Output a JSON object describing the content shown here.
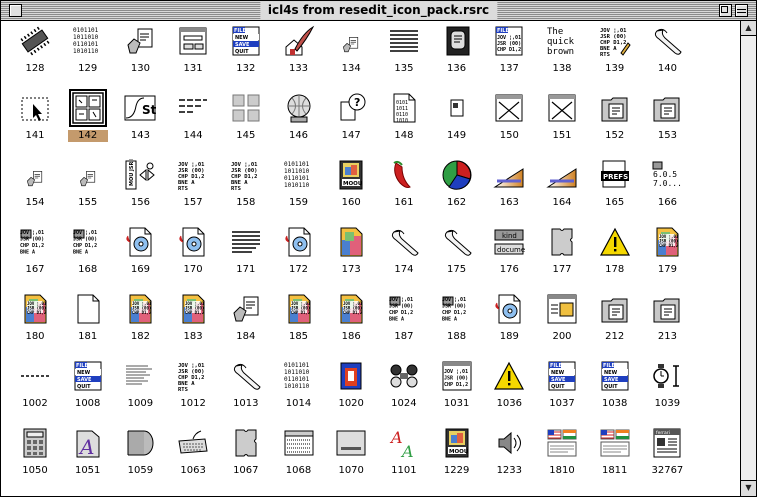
{
  "window": {
    "title": "icl4s from resedit_icon_pack.rsrc"
  },
  "selected_id": "142",
  "icons": [
    {
      "id": "128",
      "name": "chip-icon"
    },
    {
      "id": "129",
      "name": "binary-text-icon"
    },
    {
      "id": "130",
      "name": "hand-document-icon"
    },
    {
      "id": "131",
      "name": "dialog-window-icon"
    },
    {
      "id": "132",
      "name": "file-menu-icon"
    },
    {
      "id": "133",
      "name": "house-feather-icon"
    },
    {
      "id": "134",
      "name": "hand-document-small-icon"
    },
    {
      "id": "135",
      "name": "horizontal-lines-icon"
    },
    {
      "id": "136",
      "name": "dark-document-icon"
    },
    {
      "id": "137",
      "name": "code-menu-icon"
    },
    {
      "id": "138",
      "name": "quick-brown-text-icon"
    },
    {
      "id": "139",
      "name": "code-pencil-icon"
    },
    {
      "id": "140",
      "name": "scroll-icon"
    },
    {
      "id": "141",
      "name": "cursor-selection-icon"
    },
    {
      "id": "142",
      "name": "document-grid-icon"
    },
    {
      "id": "143",
      "name": "stylus-curve-icon"
    },
    {
      "id": "144",
      "name": "dashed-lines-icon"
    },
    {
      "id": "145",
      "name": "four-squares-icon"
    },
    {
      "id": "146",
      "name": "globe-icon"
    },
    {
      "id": "147",
      "name": "question-document-icon"
    },
    {
      "id": "148",
      "name": "binary-page-icon"
    },
    {
      "id": "149",
      "name": "small-document-icon"
    },
    {
      "id": "150",
      "name": "crossed-box-icon"
    },
    {
      "id": "151",
      "name": "crossed-box-icon"
    },
    {
      "id": "152",
      "name": "folder-document-icon"
    },
    {
      "id": "153",
      "name": "folder-document-icon"
    },
    {
      "id": "154",
      "name": "small-hand-document-icon"
    },
    {
      "id": "155",
      "name": "small-hand-document-icon"
    },
    {
      "id": "156",
      "name": "vertical-panel-icon"
    },
    {
      "id": "157",
      "name": "code-listing-icon"
    },
    {
      "id": "158",
      "name": "code-listing-icon"
    },
    {
      "id": "159",
      "name": "binary-text-icon"
    },
    {
      "id": "160",
      "name": "film-strip-icon"
    },
    {
      "id": "161",
      "name": "chili-pepper-icon"
    },
    {
      "id": "162",
      "name": "pie-chart-icon"
    },
    {
      "id": "163",
      "name": "gradient-ramp-icon"
    },
    {
      "id": "164",
      "name": "gradient-ramp-icon"
    },
    {
      "id": "165",
      "name": "prefs-tag-icon"
    },
    {
      "id": "166",
      "name": "version-document-icon"
    },
    {
      "id": "167",
      "name": "code-stack-icon"
    },
    {
      "id": "168",
      "name": "code-stack-icon"
    },
    {
      "id": "169",
      "name": "cd-document-icon"
    },
    {
      "id": "170",
      "name": "cd-document-icon"
    },
    {
      "id": "171",
      "name": "fading-lines-icon"
    },
    {
      "id": "172",
      "name": "cd-document-icon"
    },
    {
      "id": "173",
      "name": "color-document-icon"
    },
    {
      "id": "174",
      "name": "scroll-icon"
    },
    {
      "id": "175",
      "name": "scroll-icon"
    },
    {
      "id": "176",
      "name": "kind-document-label-icon"
    },
    {
      "id": "177",
      "name": "puzzle-piece-icon"
    },
    {
      "id": "178",
      "name": "warning-triangle-icon"
    },
    {
      "id": "179",
      "name": "color-code-document-icon"
    },
    {
      "id": "180",
      "name": "color-code-document-icon"
    },
    {
      "id": "181",
      "name": "blank-document-icon"
    },
    {
      "id": "182",
      "name": "color-code-document-icon"
    },
    {
      "id": "183",
      "name": "color-code-document-icon"
    },
    {
      "id": "184",
      "name": "hand-document-icon"
    },
    {
      "id": "185",
      "name": "color-code-document-icon"
    },
    {
      "id": "186",
      "name": "color-code-document-icon"
    },
    {
      "id": "187",
      "name": "code-stack-icon"
    },
    {
      "id": "188",
      "name": "code-stack-icon"
    },
    {
      "id": "189",
      "name": "cd-document-icon"
    },
    {
      "id": "200",
      "name": "installer-window-icon"
    },
    {
      "id": "212",
      "name": "folder-document-icon"
    },
    {
      "id": "213",
      "name": "folder-document-icon"
    },
    {
      "id": "1002",
      "name": "dashed-line-icon"
    },
    {
      "id": "1008",
      "name": "file-menu-icon"
    },
    {
      "id": "1009",
      "name": "text-lines-icon"
    },
    {
      "id": "1012",
      "name": "code-listing-icon"
    },
    {
      "id": "1013",
      "name": "scroll-icon"
    },
    {
      "id": "1014",
      "name": "binary-text-icon"
    },
    {
      "id": "1020",
      "name": "blue-folder-document-icon"
    },
    {
      "id": "1024",
      "name": "binoculars-icon"
    },
    {
      "id": "1031",
      "name": "code-window-icon"
    },
    {
      "id": "1036",
      "name": "warning-triangle-icon"
    },
    {
      "id": "1037",
      "name": "file-menu-icon"
    },
    {
      "id": "1038",
      "name": "file-menu-icon"
    },
    {
      "id": "1039",
      "name": "watch-text-cursor-icon"
    },
    {
      "id": "1050",
      "name": "calculator-icon"
    },
    {
      "id": "1051",
      "name": "font-document-icon"
    },
    {
      "id": "1059",
      "name": "cylinder-icon"
    },
    {
      "id": "1063",
      "name": "keyboard-icon"
    },
    {
      "id": "1067",
      "name": "puzzle-piece-icon"
    },
    {
      "id": "1068",
      "name": "tabbed-list-icon"
    },
    {
      "id": "1070",
      "name": "drive-icon"
    },
    {
      "id": "1101",
      "name": "font-letters-icon"
    },
    {
      "id": "1229",
      "name": "film-strip-icon"
    },
    {
      "id": "1233",
      "name": "speaker-icon"
    },
    {
      "id": "1810",
      "name": "flags-icon"
    },
    {
      "id": "1811",
      "name": "flags-icon"
    },
    {
      "id": "32767",
      "name": "calendar-document-icon"
    }
  ],
  "text_snippets": {
    "binary": [
      "0101101",
      "1011010",
      "0110101",
      "1010110"
    ],
    "code": [
      "JOV ¦,01",
      "JSR (00)",
      "CHP D1,2",
      "BNE A",
      "RTS"
    ],
    "quick": [
      "The",
      "quick",
      "brown"
    ],
    "menu": [
      "FILE",
      "NEW",
      "SAVE",
      "QUIT"
    ],
    "kind": [
      "kind",
      "docume"
    ],
    "version": [
      "6.0.5",
      "7.0..."
    ],
    "prefs": "PREFS",
    "font": [
      "A",
      "A"
    ],
    "movie": "MOOU",
    "vertical": [
      "MOU",
      "JSR",
      "BNE"
    ],
    "calendar": "ferrari"
  },
  "colors": {
    "selection": "#c49a6c",
    "accent_blue": "#1f3fbf",
    "accent_red": "#cc2020",
    "warning_yellow": "#f5d800"
  }
}
